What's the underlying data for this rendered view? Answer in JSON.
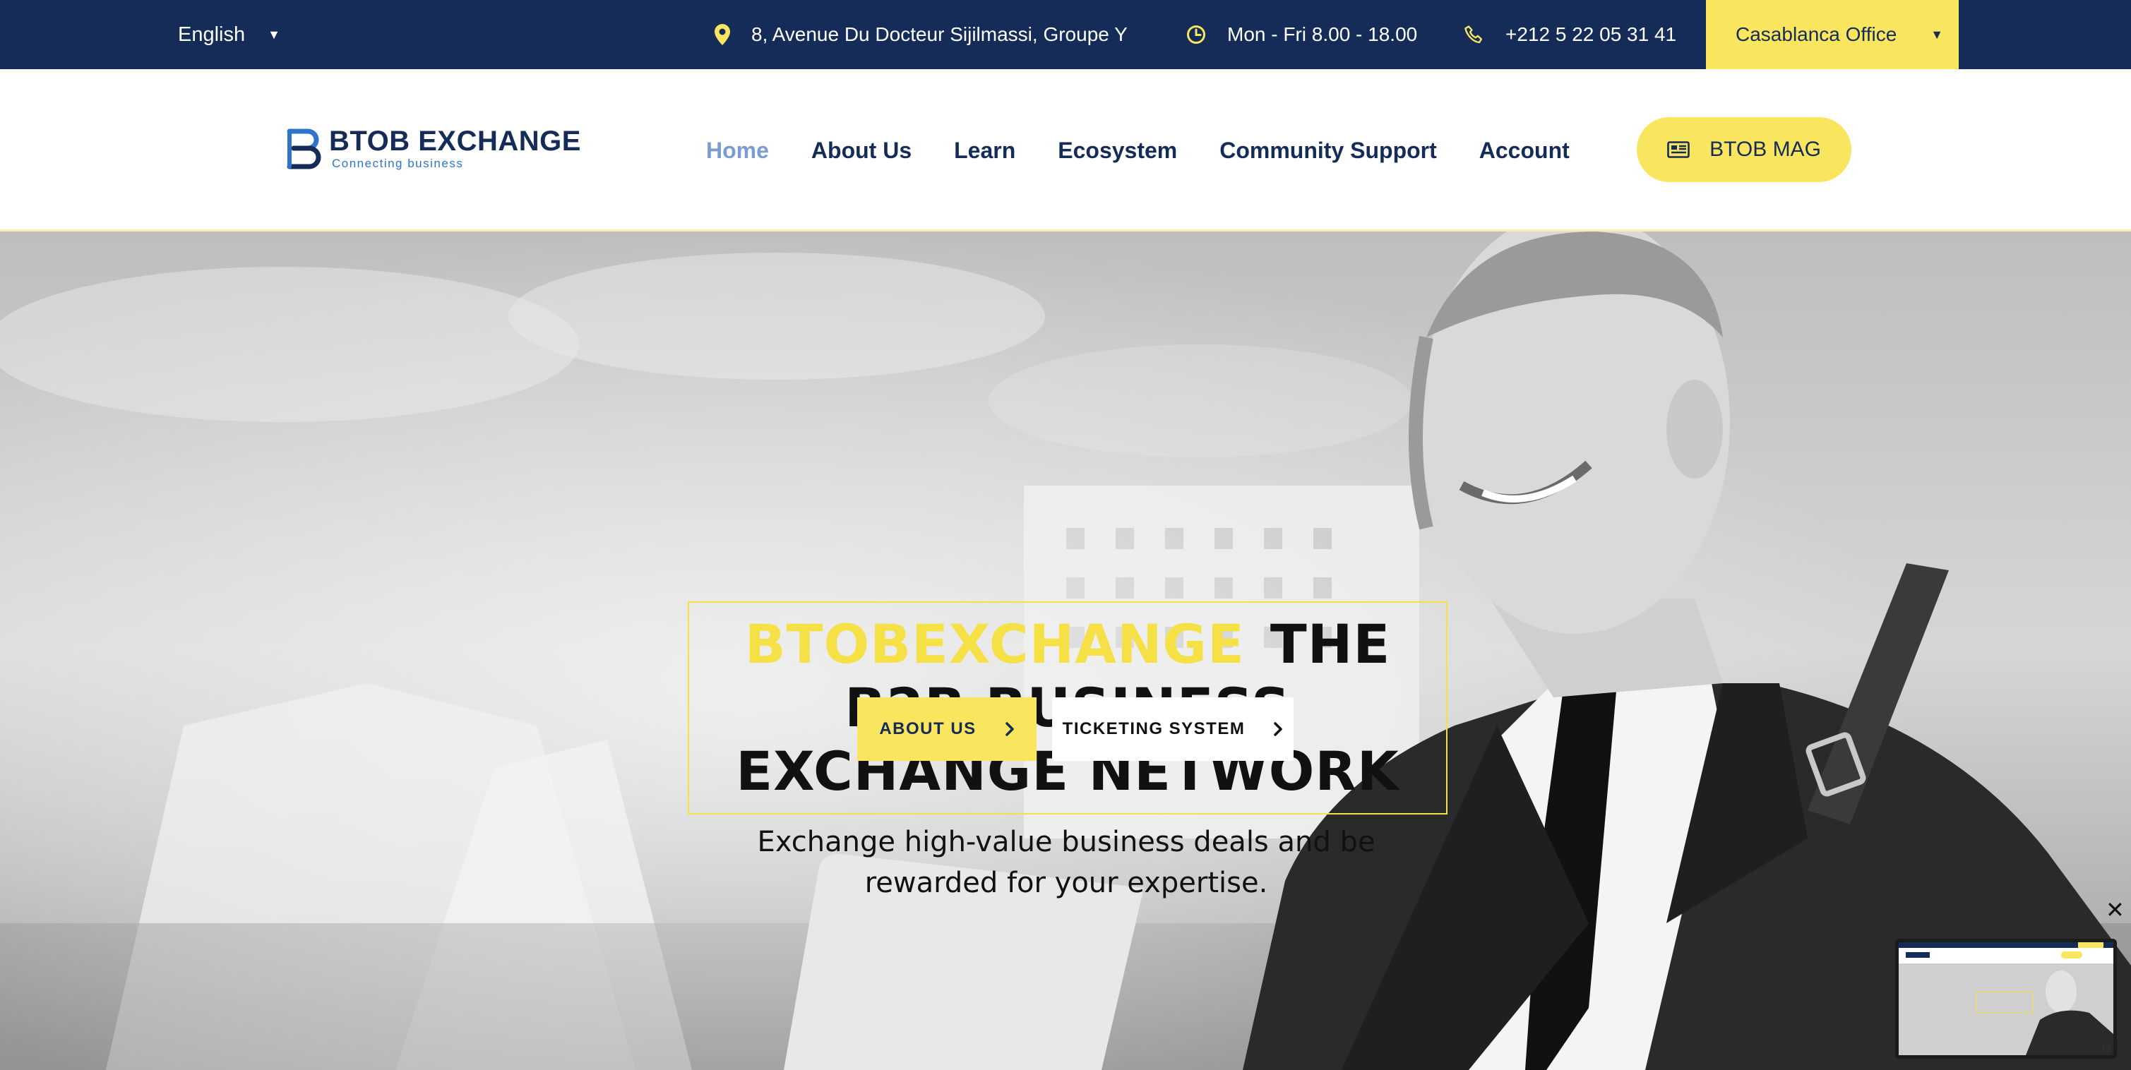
{
  "topbar": {
    "language": "English",
    "address": "8, Avenue Du Docteur Sijilmassi, Groupe Y",
    "hours": "Mon - Fri 8.00 - 18.00",
    "phone": "+212 5 22 05 31 41",
    "office": "Casablanca Office"
  },
  "header": {
    "logo_name": "BTOB EXCHANGE",
    "logo_tagline": "Connecting business",
    "nav": [
      {
        "label": "Home",
        "active": true
      },
      {
        "label": "About Us",
        "active": false
      },
      {
        "label": "Learn",
        "active": false
      },
      {
        "label": "Ecosystem",
        "active": false
      },
      {
        "label": "Community Support",
        "active": false
      },
      {
        "label": "Account",
        "active": false
      }
    ],
    "mag_button": "BTOB MAG"
  },
  "hero": {
    "brand": "BTOBEXCHANGE",
    "headline_line1_rest": "THE",
    "headline_line2": "B2B BUSINESS",
    "headline_line3": "EXCHANGE NETWORK",
    "subtitle": "Exchange high-value business deals and be rewarded for your expertise.",
    "about_button": "ABOUT US",
    "ticket_button": "TICKETING SYSTEM"
  },
  "widget": {
    "close": "✕"
  },
  "colors": {
    "navy": "#142c57",
    "yellow": "#f9e55e",
    "headline_yellow": "#f5e046",
    "nav_active": "#7b9bd3"
  }
}
